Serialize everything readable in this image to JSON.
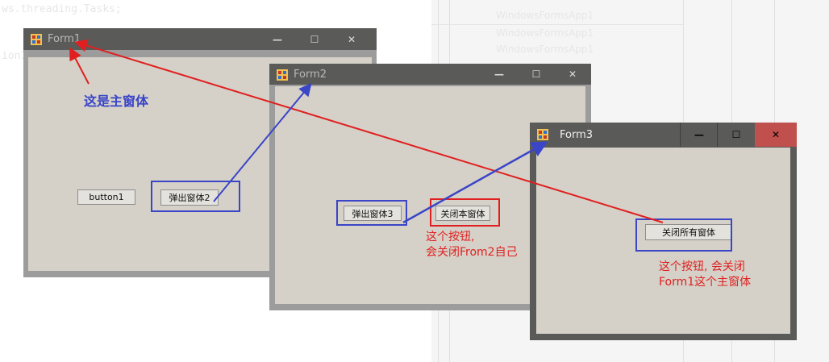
{
  "background_code": [
    "ws.threading.Tasks;",
    "ion1"
  ],
  "background_tree": [
    "WindowsFormsApp1",
    "WindowsFormsApp1",
    "WindowsFormsApp1"
  ],
  "form1": {
    "title": "Form1",
    "minimize": "—",
    "maximize": "☐",
    "close": "✕",
    "button1_label": "button1",
    "popup_label": "弹出窗体2"
  },
  "form2": {
    "title": "Form2",
    "minimize": "—",
    "maximize": "☐",
    "close": "✕",
    "popup_label": "弹出窗体3",
    "close_self_label": "关闭本窗体"
  },
  "form3": {
    "title": "Form3",
    "minimize": "—",
    "maximize": "☐",
    "close": "✕",
    "close_all_label": "关闭所有窗体"
  },
  "annotations": {
    "main_form_note": "这是主窗体",
    "form2_note_line1": "这个按钮,",
    "form2_note_line2": "会关闭From2自己",
    "form3_note_line1": "这个按钮, 会关闭",
    "form3_note_line2": "Form1这个主窗体"
  },
  "colors": {
    "annotation_red": "#e02020",
    "annotation_blue": "#3a45c8",
    "close_button_red": "#c0504d",
    "titlebar": "#5a5a58",
    "client": "#d5d1c8"
  }
}
